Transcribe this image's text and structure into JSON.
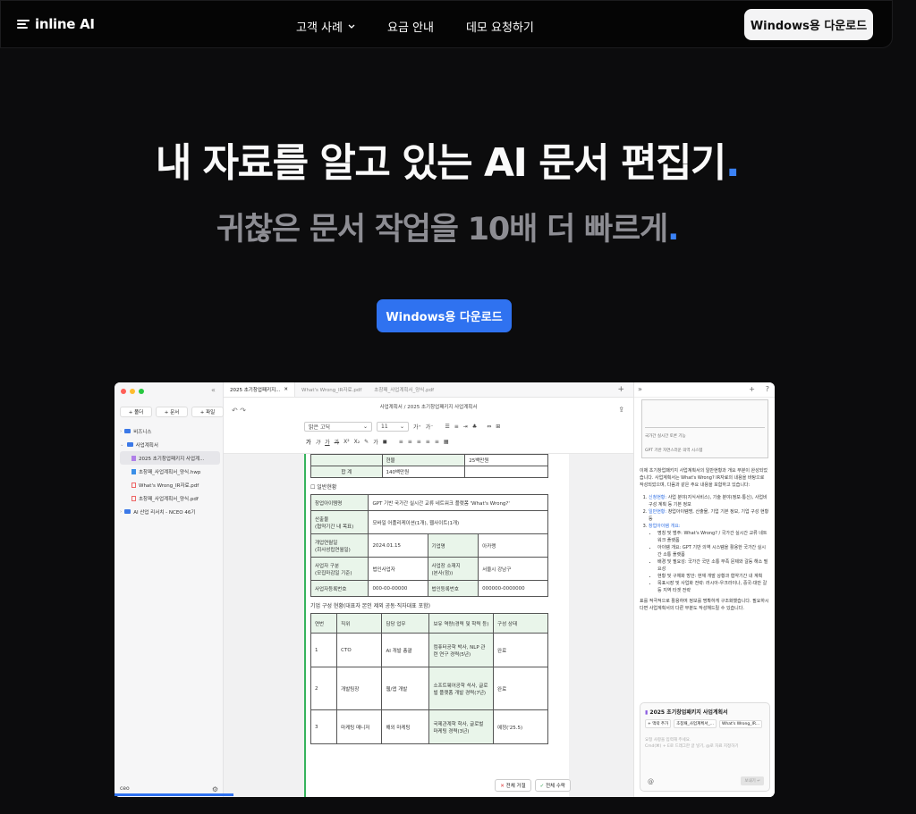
{
  "nav": {
    "logo": "inline AI",
    "links": [
      "고객 사례",
      "요금 안내",
      "데모 요청하기"
    ],
    "cta": "Windows용 다운로드"
  },
  "hero": {
    "title": "내 자료를 알고 있는 AI 문서 편집기",
    "title_dot": ".",
    "subtitle": "귀찮은 문서 작업을 10배 더 빠르게",
    "subtitle_dot": ".",
    "cta": "Windows용 다운로드"
  },
  "colors": {
    "accent": "#2f72f0",
    "bg": "#0c0c0d",
    "doc_green": "#37b35d"
  },
  "app": {
    "sidebar": {
      "buttons": [
        "+ 폴더",
        "+ 문서",
        "+ 파일"
      ],
      "tree": [
        {
          "label": "비즈니스",
          "type": "folder"
        },
        {
          "label": "사업계획서",
          "type": "folder"
        },
        {
          "label": "2025 초기창업패키지 사업계...",
          "type": "doc"
        },
        {
          "label": "초창패_사업계획서_양식.hwp",
          "type": "hwp"
        },
        {
          "label": "What's Wrong_IR자료.pdf",
          "type": "pdf"
        },
        {
          "label": "초창패_사업계획서_양식.pdf",
          "type": "pdf"
        },
        {
          "label": "AI 산업 리서치 - NCEO 46기",
          "type": "folder"
        }
      ],
      "footer": "ceo"
    },
    "tabs": [
      "2025 초기창업패키지...",
      "What's Wrong_IR자료.pdf",
      "초창패_사업계획서_양식.pdf"
    ],
    "breadcrumb": "사업계획서 / 2025 초기창업패키지 사업계획서",
    "font_select": "맑은 고딕",
    "size_select": "11",
    "doc": {
      "top_rows": [
        [
          "",
          "현물",
          "25백만원"
        ],
        [
          "합 계",
          "140백만원",
          ""
        ]
      ],
      "section1": "☐ 일반현황",
      "info_rows": [
        [
          "창업아이템명",
          "GPT 기반 국가간 실시간 교류 네트워크 플랫폼 'What's Wrong?'",
          "",
          ""
        ],
        [
          "산출물\n(협약기간 내 목표)",
          "모바일 어플리케이션(1개), 웹사이트(1개)",
          "",
          ""
        ],
        [
          "개업연월일\n(회사성립연월일)",
          "2024.01.15",
          "기업명",
          "아카랭"
        ],
        [
          "사업자 구분\n(모집마감일 기준)",
          "법인사업자",
          "사업장 소재지\n(본사(점))",
          "서울시 강남구"
        ],
        [
          "사업자등록번호",
          "000-00-00000",
          "법인등록번호",
          "000000-0000000"
        ]
      ],
      "section2": "기업 구성 현황(대표자 본인 제외 공동·직자대표 포함)",
      "team_header": [
        "연번",
        "직위",
        "담당 업무",
        "보유 역량(경력 및 학력 등)",
        "구성 상태"
      ],
      "team_rows": [
        [
          "1",
          "CTO",
          "AI 개발 총괄",
          "컴퓨터공학 박사, NLP 관련 연구 경력(5년)",
          "완료"
        ],
        [
          "2",
          "개발팀장",
          "웹/앱 개발",
          "소프트웨어공학 석사, 글로벌 플랫폼 개발 경력(7년)",
          "완료"
        ],
        [
          "3",
          "마케팅 매니저",
          "해외 마케팅",
          "국제관계학 학사, 글로벌 마케팅 경력(3년)",
          "예정('25.5)"
        ]
      ],
      "reject_all": "전체 거절",
      "accept_all": "전체 수락"
    },
    "chat": {
      "image_caption_1": "국가간 실시간 토론 기능",
      "image_caption_2": "GPT 기반 자연스러운 의역 시스템",
      "intro": "이제 초기창업패키지 사업계획서의 일반현황과 개요 부분이 완성되었습니다. 사업계획서는 What's Wrong? IR자료의 내용을 바탕으로 작성되었으며, 다음과 같은 주요 내용을 포함하고 있습니다:",
      "items": [
        {
          "title": "신청현황:",
          "text": "사업 분야(지식서비스), 기술 분야(정보·통신), 사업비 구성 계획 등 기본 정보"
        },
        {
          "title": "일반현황:",
          "text": "창업아이템명, 산출물, 기업 기본 정보, 기업 구성 현황 등"
        },
        {
          "title": "창업아이템 개요:",
          "text": ""
        }
      ],
      "bullets": [
        "명칭 및 범주: What's Wrong? / 국가간 실시간 교류 네트워크 플랫폼",
        "아이템 개요: GPT 기반 의역 시스템을 활용한 국가간 실시간 소통 플랫폼",
        "배경 및 필요성: 국가간 국민 소통 부족 문제와 갈등 해소 필요성",
        "현황 및 구체화 방안: 현재 개발 상황과 협약기간 내 계획",
        "목표시장 및 사업화 전략: 러시아-우크라이나, 중국-대만 갈등 지역 타겟 전략"
      ],
      "outro": "표를 적극적으로 활용하여 정보를 명확하게 구조화했습니다. 필요하시다면 사업계획서의 다른 부분도 작성해드릴 수 있습니다.",
      "box_title": "2025 초기창업패키지 사업계획서",
      "chips": [
        "+ 맥락 추가",
        "초창패_사업계획서_...",
        "What's Wrong_IR..."
      ],
      "placeholder": "요청 사항을 입력해 주세요.",
      "hint": "Cmd(⌘) + E로 드래그한 글 넣기, @로 자료 지정하기",
      "send": "보내기 ↵"
    }
  }
}
